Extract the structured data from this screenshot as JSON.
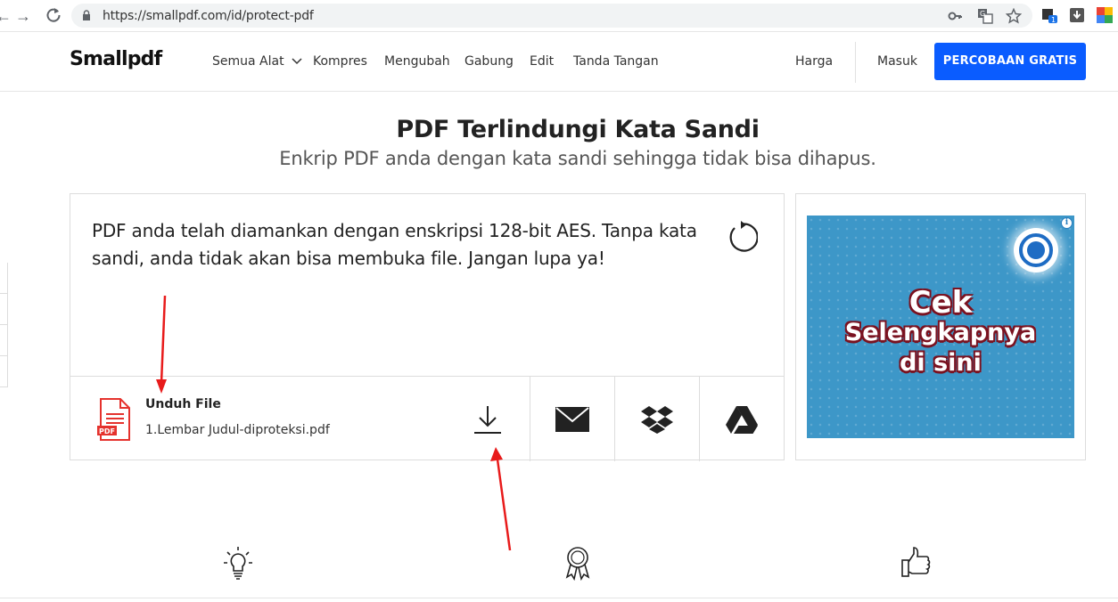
{
  "browser": {
    "url": "https://smallpdf.com/id/protect-pdf",
    "extension_badge": "1"
  },
  "header": {
    "logo": "Smallpdf",
    "nav": [
      "Semua Alat",
      "Kompres",
      "Mengubah",
      "Gabung",
      "Edit",
      "Tanda Tangan"
    ],
    "pricing": "Harga",
    "login": "Masuk",
    "trial_button": "PERCOBAAN GRATIS"
  },
  "hero": {
    "title": "PDF Terlindungi Kata Sandi",
    "subtitle": "Enkrip PDF anda dengan kata sandi sehingga tidak bisa dihapus."
  },
  "result": {
    "message": "PDF anda telah diamankan dengan enskripsi 128-bit AES. Tanpa kata sandi, anda tidak akan bisa membuka file. Jangan lupa ya!",
    "download_label": "Unduh File",
    "file_name": "1.Lembar Judul-diproteksi.pdf",
    "file_badge": "PDF"
  },
  "ad": {
    "line1": "Cek",
    "line2": "Selengkapnya",
    "line3": "di sini",
    "info": "i"
  }
}
